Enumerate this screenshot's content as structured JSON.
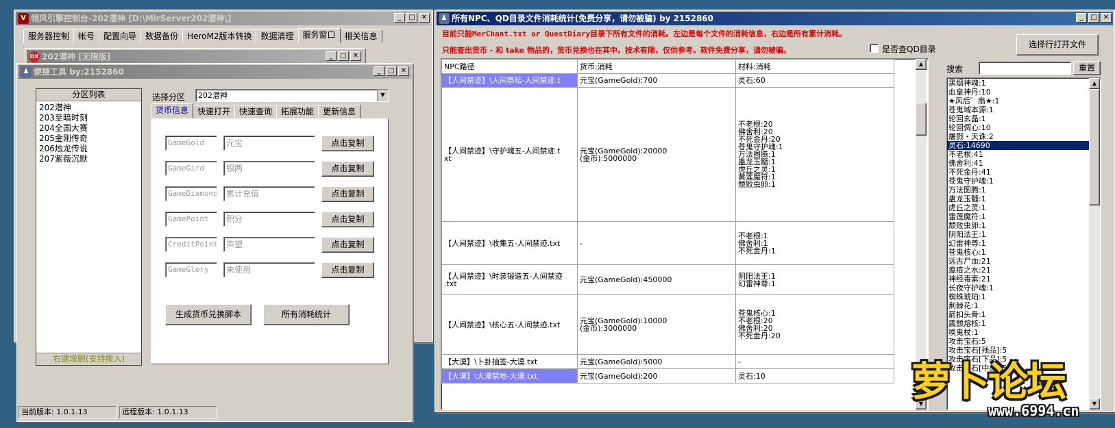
{
  "win_main": {
    "title": "翎风引擎控制台-202潜神 [D:\\MirServer202潜神\\]",
    "menu_tabs": [
      "服务器控制",
      "帐号",
      "配置向导",
      "数据备份",
      "HeroM2版本转换",
      "数据清理",
      "服务窗口",
      "相关信息"
    ]
  },
  "win_sub": {
    "badge": "DX",
    "title": "202潜神 [无限版]"
  },
  "win_tool": {
    "title": "便捷工具   by:2152860",
    "partition_header": "分区列表",
    "partitions": [
      "202潜神",
      "203至暗时刻",
      "204全国大赛",
      "205金刚传奇",
      "206烛龙传说",
      "207紫薇沉默"
    ],
    "partition_footer": "右键增删(支持拖入)",
    "select_label": "选择分区",
    "select_value": "202潜神",
    "tabs": [
      "货币信息",
      "快速打开",
      "快速查询",
      "拓展功能",
      "更新信息"
    ],
    "rows": [
      {
        "var": "GameGold",
        "name": "元宝",
        "button": "点击复制"
      },
      {
        "var": "GameGird",
        "name": "银两",
        "button": "点击复制"
      },
      {
        "var": "GameDiamond",
        "name": "累计充值",
        "button": "点击复制"
      },
      {
        "var": "GamePoint",
        "name": "积分",
        "button": "点击复制"
      },
      {
        "var": "CreditPoint",
        "name": "声望",
        "button": "点击复制"
      },
      {
        "var": "GameGlory",
        "name": "未使用",
        "button": "点击复制"
      }
    ],
    "btn_generate": "生成货币兑换脚本",
    "btn_stats": "所有消耗统计",
    "status_current": "当前版本: 1.0.1.13",
    "status_remote": "远程版本: 1.0.1.13"
  },
  "win_stats": {
    "title": "所有NPC、QD目录文件消耗统计(免费分享，请勿被骗)    by 2152860",
    "notice1": "目前只能MerChant.txt or QuestDiary目录下所有文件的消耗。左边是每个文件的消耗信息，右边是所有累计消耗。",
    "notice2": "只能查出货币 - 和 take 物品的，货币兑换也在其中。技术有限，仅供参考。软件免费分享，请勿被骗。",
    "checkbox_label": "是否查QD目录",
    "btn_open": "选择行打开文件",
    "search_label": "搜索",
    "btn_reset": "重置",
    "columns": [
      "NPC路径",
      "货币:消耗",
      "材料:消耗"
    ],
    "rows": [
      {
        "path": "【人间禁迹】\\人间祭坛-人间禁迹.t",
        "currency": "元宝(GameGold):700",
        "materials": "灵石:60"
      },
      {
        "path": "【人间禁迹】\\守护魂五-人间禁迹.t\nxt",
        "currency": "元宝(GameGold):20000\n(金币):5000000",
        "materials": "不老根:20\n佛舍利:20\n不死金丹:20\n苍鬼守护魂:1\n万法图腾:1\n蛊龙玉髓:1\n虎丘之灵:1\n黄莲魔符:1\n颓败虫卵:1"
      },
      {
        "path": "【人间禁迹】\\收集五-人间禁迹.txt",
        "currency": "-",
        "materials": "不老根:1\n佛舍利:1\n不死金丹:1"
      },
      {
        "path": "【人间禁迹】\\时装锻造五-人间禁迹\n.txt",
        "currency": "元宝(GameGold):450000",
        "materials": "阴阳法王:1\n幻雷神尊:1"
      },
      {
        "path": "【人间禁迹】\\核心五-人间禁迹.txt",
        "currency": "元宝(GameGold):10000\n(金币):3000000",
        "materials": "苍鬼核心:1\n不老根:20\n佛舍利:20\n不死金丹:20"
      },
      {
        "path": "【大漠】\\卜卦抽签-大漠.txt",
        "currency": "元宝(GameGold):5000",
        "materials": "-"
      },
      {
        "path": "【大漠】\\大漠禁地-大漠.txt",
        "currency": "元宝(GameGold):200",
        "materials": "灵石:10"
      }
    ],
    "summary": [
      "黑烟神魂:1",
      "血皇神丹:10",
      "★风后゛扇★:1",
      "苍鬼域本源:1",
      "轮回玄晶:1",
      "轮回倜心:10",
      "屠戮・天诛:2",
      "灵石:14690",
      "不老根:41",
      "佛舍利:41",
      "不死金丹:41",
      "苍鬼守护魂:1",
      "万法图腾:1",
      "蛊龙玉髓:1",
      "虎丘之灵:1",
      "雷莲魔符:1",
      "颓败虫卵:1",
      "阴阳法王:1",
      "幻雷神尊:1",
      "苍鬼核心:1",
      "远古尸血:21",
      "瘟疫之水:21",
      "神经毒素:21",
      "长夜守护魂:1",
      "蜘蛛琥珀:1",
      "荆棘花:1",
      "箭扣头骨:1",
      "震颤熔核:1",
      "唤鬼杖:1",
      "攻击宝石:5",
      "攻击宝石[残品]:5",
      "攻击宝石[下品]:5",
      "攻击宝石[中品]:5"
    ],
    "summary_selected": 7
  },
  "watermark": {
    "brand": "萝卜论坛",
    "url": "www.6994.cn"
  }
}
